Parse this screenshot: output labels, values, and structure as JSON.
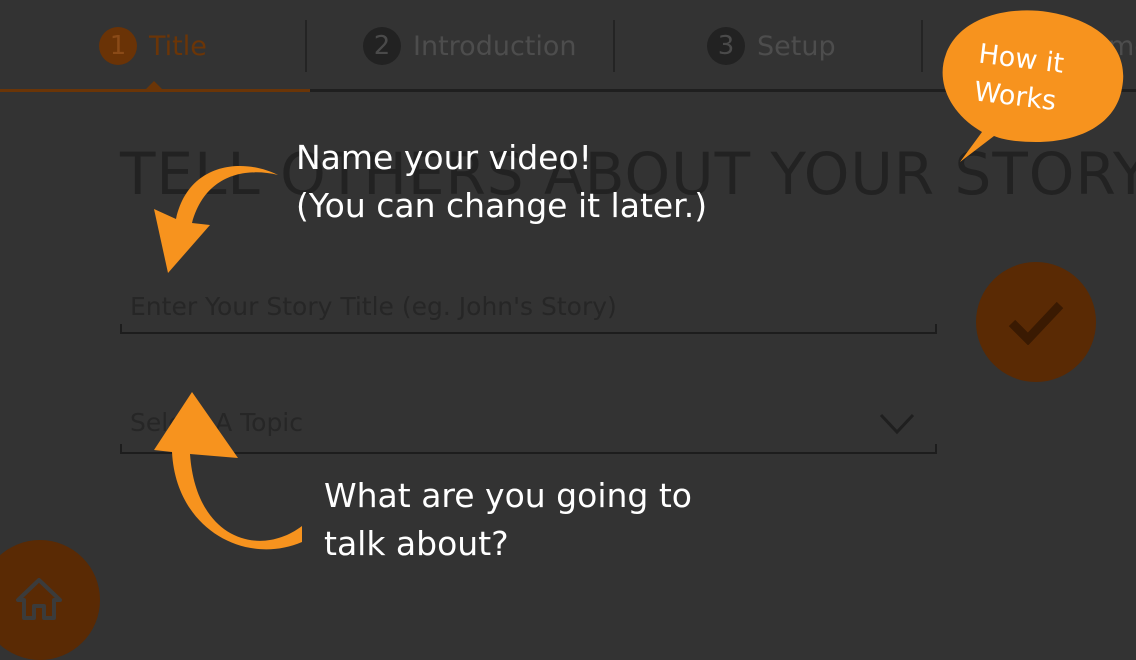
{
  "steps": [
    {
      "number": "1",
      "label": "Title",
      "active": true
    },
    {
      "number": "2",
      "label": "Introduction",
      "active": false
    },
    {
      "number": "3",
      "label": "Setup",
      "active": false
    },
    {
      "label_partial": "me"
    }
  ],
  "heading": "TELL OTHERS ABOUT YOUR STORY",
  "title_field": {
    "placeholder": "Enter Your Story Title (eg. John's Story)",
    "value": ""
  },
  "topic_field": {
    "selected": "Select A Topic"
  },
  "how_it_works": {
    "line1": "How it",
    "line2": "Works"
  },
  "callouts": {
    "name_video": {
      "line1": "Name your video!",
      "line2": "(You can change it later.)"
    },
    "topic": {
      "line1": "What are you going to",
      "line2": "talk about?"
    }
  },
  "colors": {
    "accent": "#f7931e",
    "background": "#333333",
    "dimmed_accent": "#5a2a04"
  },
  "icons": {
    "confirm": "checkmark-icon",
    "home": "home-icon",
    "dropdown": "chevron-down-icon"
  }
}
